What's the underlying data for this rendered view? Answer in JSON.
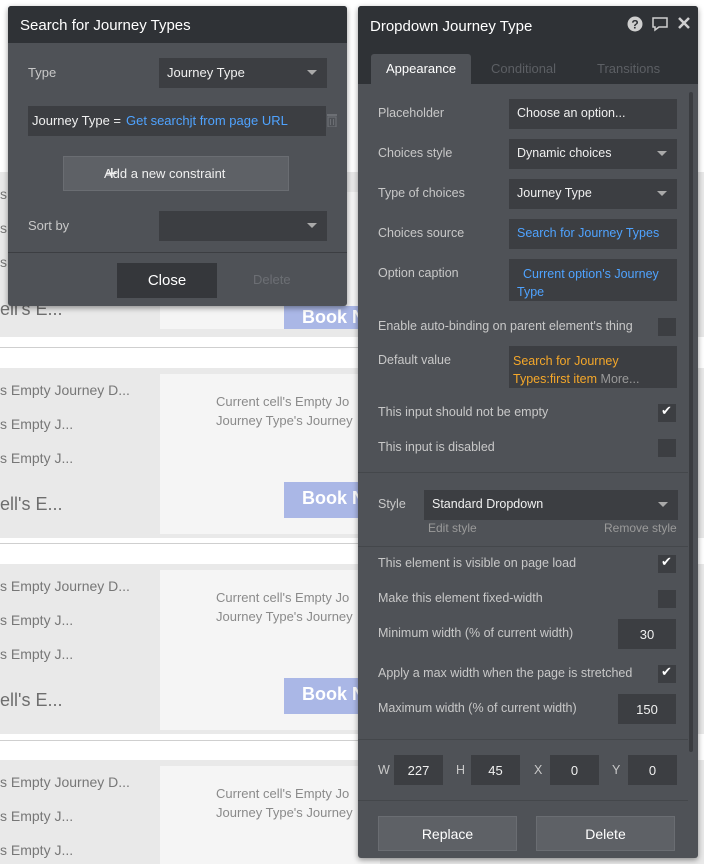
{
  "canvas": {
    "rows": [
      {
        "line1": "s Empty Journey D...",
        "line2": "s Empty J...",
        "line3": "s Empty J...",
        "big": "ell's E...",
        "card_line1": "Current cell's Empty Jo",
        "card_line2": "Journey Type's Journey",
        "book": "Book N"
      },
      {
        "line1": "s Empty Journey D...",
        "line2": "s Empty J...",
        "line3": "s Empty J...",
        "big": "ell's E...",
        "card_line1": "Current cell's Empty Jo",
        "card_line2": "Journey Type's Journey",
        "book": "Book N"
      },
      {
        "line1": "s Empty Journey D...",
        "line2": "s Empty J...",
        "line3": "s Empty J...",
        "big": "",
        "card_line1": "Current cell's Empty Jo",
        "card_line2": "Journey Type's Journey",
        "book": ""
      }
    ],
    "top_fragments": {
      "s1": "s",
      "s2": "s",
      "s3": "s",
      "cells": "ell's E...",
      "book": "Book N"
    }
  },
  "search_panel": {
    "title": "Search for Journey Types",
    "type_label": "Type",
    "type_value": "Journey Type",
    "constraint_key": "Journey Type =",
    "constraint_value": "Get searchjt from page URL",
    "add_constraint": "Add a new constraint",
    "sort_label": "Sort by",
    "sort_value": "",
    "close": "Close",
    "delete": "Delete"
  },
  "prop_panel": {
    "title": "Dropdown Journey Type",
    "tabs": [
      "Appearance",
      "Conditional",
      "Transitions"
    ],
    "placeholder_label": "Placeholder",
    "placeholder_value": "Choose an option...",
    "choices_style_label": "Choices style",
    "choices_style_value": "Dynamic choices",
    "type_choices_label": "Type of choices",
    "type_choices_value": "Journey Type",
    "choices_source_label": "Choices source",
    "choices_source_value": "Search for Journey Types",
    "option_caption_label": "Option caption",
    "option_caption_line1": "Current option's Journey",
    "option_caption_line2": "Type",
    "auto_binding_label": "Enable auto-binding on parent element's thing",
    "default_value_label": "Default value",
    "default_value_line1": "Search for Journey",
    "default_value_line2": "Types:first item",
    "default_more": "More...",
    "not_empty_label": "This input should not be empty",
    "disabled_label": "This input is disabled",
    "style_label": "Style",
    "style_value": "Standard Dropdown",
    "edit_style": "Edit style",
    "remove_style": "Remove style",
    "visible_label": "This element is visible on page load",
    "fixed_width_label": "Make this element fixed-width",
    "min_width_label": "Minimum width (% of current width)",
    "min_width_value": "30",
    "max_apply_label": "Apply a max width when the page is stretched",
    "max_width_label": "Maximum width (% of current width)",
    "max_width_value": "150",
    "w_label": "W",
    "w_value": "227",
    "h_label": "H",
    "h_value": "45",
    "x_label": "X",
    "x_value": "0",
    "y_label": "Y",
    "y_value": "0",
    "replace": "Replace",
    "delete": "Delete"
  },
  "checkboxes": {
    "auto_binding": false,
    "not_empty": true,
    "disabled": false,
    "visible": true,
    "fixed_width": false,
    "max_apply": true
  },
  "colors": {
    "panel_bg": "#4f5257",
    "header_bg": "#2f3236",
    "input_bg": "#3c3e42",
    "link_blue": "#4fa3ff",
    "expr_orange": "#f4a72a",
    "book_button": "#aab7e6"
  },
  "icons": [
    "help-icon",
    "comment-icon",
    "close-icon",
    "trash-icon",
    "plus-icon",
    "caret-down-icon",
    "check-icon"
  ]
}
